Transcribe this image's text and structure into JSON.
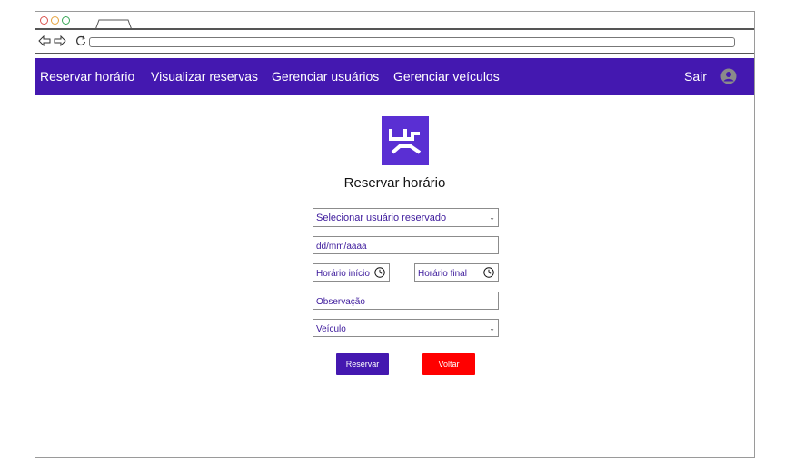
{
  "navbar": {
    "items": [
      {
        "label": "Reservar horário"
      },
      {
        "label": "Visualizar reservas"
      },
      {
        "label": "Gerenciar  usuários"
      },
      {
        "label": "Gerenciar  veículos"
      }
    ],
    "logout_label": "Sair"
  },
  "page": {
    "title": "Reservar horário"
  },
  "form": {
    "user_select": {
      "value": "Selecionar usuário reservado"
    },
    "date": {
      "placeholder": "dd/mm/aaaa"
    },
    "time_start": {
      "placeholder": "Horário início"
    },
    "time_end": {
      "placeholder": "Horário final"
    },
    "observation": {
      "placeholder": "Observação"
    },
    "vehicle_select": {
      "value": "Veículo"
    },
    "submit_label": "Reservar",
    "back_label": "Voltar"
  },
  "colors": {
    "brand": "#4418b0",
    "logo": "#5a2fd3",
    "danger": "#ff0000"
  },
  "icons": {
    "logo": "brand-logo-icon",
    "avatar": "user-avatar-icon",
    "clock": "clock-icon",
    "dropdown": "chevron-down-icon"
  }
}
